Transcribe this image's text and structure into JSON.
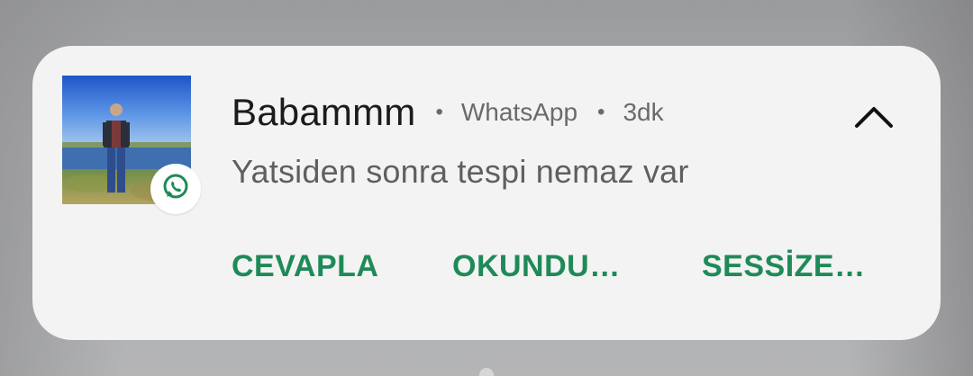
{
  "notification": {
    "sender": "Babammm",
    "separator": "•",
    "app_name": "WhatsApp",
    "time": "3dk",
    "message": "Yatsiden sonra tespi nemaz var",
    "app_icon": "whatsapp-icon",
    "expand_icon": "chevron-up-icon",
    "accent_color": "#1f8a58",
    "actions": [
      {
        "label": "CEVAPLA"
      },
      {
        "label": "OKUNDU…"
      },
      {
        "label": "SESSİZE…"
      }
    ]
  }
}
